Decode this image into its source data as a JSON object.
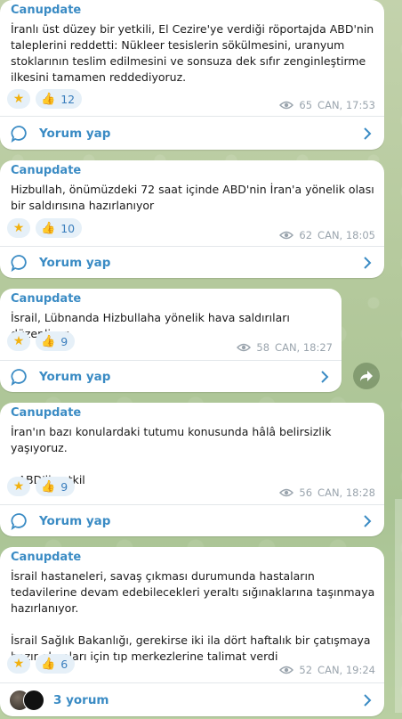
{
  "channel_sender": "Canupdate",
  "comment_label": "Yorum yap",
  "messages": [
    {
      "text": "İranlı üst düzey bir yetkili, El Cezire'ye verdiği röportajda ABD'nin taleplerini reddetti: Nükleer tesislerin sökülmesini, uranyum stoklarının teslim edilmesini ve sonsuza dek sıfır zenginleştirme ilkesini tamamen reddediyoruz.",
      "likes": "12",
      "views": "65",
      "time": "CAN, 17:53"
    },
    {
      "text": "Hizbullah, önümüzdeki 72 saat içinde ABD'nin İran'a yönelik olası bir saldırısına hazırlanıyor",
      "likes": "10",
      "views": "62",
      "time": "CAN, 18:05"
    },
    {
      "text": "İsrail, Lübnanda Hizbullaha yönelik hava saldırıları düzenliyor",
      "likes": "9",
      "views": "58",
      "time": "CAN, 18:27"
    },
    {
      "text": "İran'ın bazı konulardaki tutumu konusunda hâlâ belirsizlik yaşıyoruz.\n\n- ABD'li yetkil",
      "likes": "9",
      "views": "56",
      "time": "CAN, 18:28"
    },
    {
      "text": "İsrail hastaneleri, savaş çıkması durumunda hastaların tedavilerine devam edebilecekleri yeraltı sığınaklarına taşınmaya hazırlanıyor.\n\nİsrail Sağlık Bakanlığı, gerekirse iki ila dört haftalık bir çatışmaya hazır olmaları için tıp merkezlerine talimat verdi",
      "likes": "6",
      "views": "52",
      "time": "CAN, 19:24",
      "comment_count_label": "3 yorum"
    }
  ],
  "colors": {
    "accent": "#3a8bc4",
    "reaction_bg": "#e6f0f8",
    "meta": "#9aa4ad"
  }
}
